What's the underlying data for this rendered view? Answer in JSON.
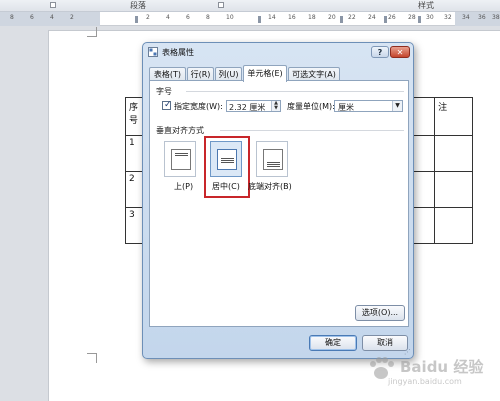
{
  "ribbon": {
    "group_paragraph": "段落",
    "group_styles": "样式"
  },
  "ruler": {
    "ticks": [
      "8",
      "6",
      "4",
      "2",
      "2",
      "4",
      "6",
      "8",
      "10",
      "14",
      "16",
      "18",
      "20",
      "22",
      "24",
      "26",
      "28",
      "30",
      "32",
      "34",
      "36",
      "38"
    ]
  },
  "doc_table": {
    "header_first": "序号",
    "header_last": "注",
    "row_numbers": [
      "1",
      "2",
      "3"
    ]
  },
  "dialog": {
    "title": "表格属性",
    "help_label": "?",
    "close_label": "✕",
    "tabs": [
      {
        "label": "表格(T)"
      },
      {
        "label": "行(R)"
      },
      {
        "label": "列(U)"
      },
      {
        "label": "单元格(E)",
        "active": true
      },
      {
        "label": "可选文字(A)"
      }
    ],
    "size_section": "字号",
    "preferred_width_checked": true,
    "preferred_width_label": "指定宽度(W):",
    "preferred_width_value": "2.32 厘米",
    "measure_in_label": "度量单位(M):",
    "measure_in_value": "厘米",
    "valign_section": "垂直对齐方式",
    "valign_options": [
      {
        "label": "上(P)"
      },
      {
        "label": "居中(C)",
        "selected": true
      },
      {
        "label": "底端对齐(B)"
      }
    ],
    "options_button": "选项(O)...",
    "ok_button": "确定",
    "cancel_button": "取消"
  },
  "watermark": {
    "text_main": "Baidu 经验",
    "text_url": "jingyan.baidu.com"
  },
  "colors": {
    "highlight_box": "#c8262a",
    "dialog_frame": "#6d8fb7",
    "close_button": "#c4452d"
  }
}
